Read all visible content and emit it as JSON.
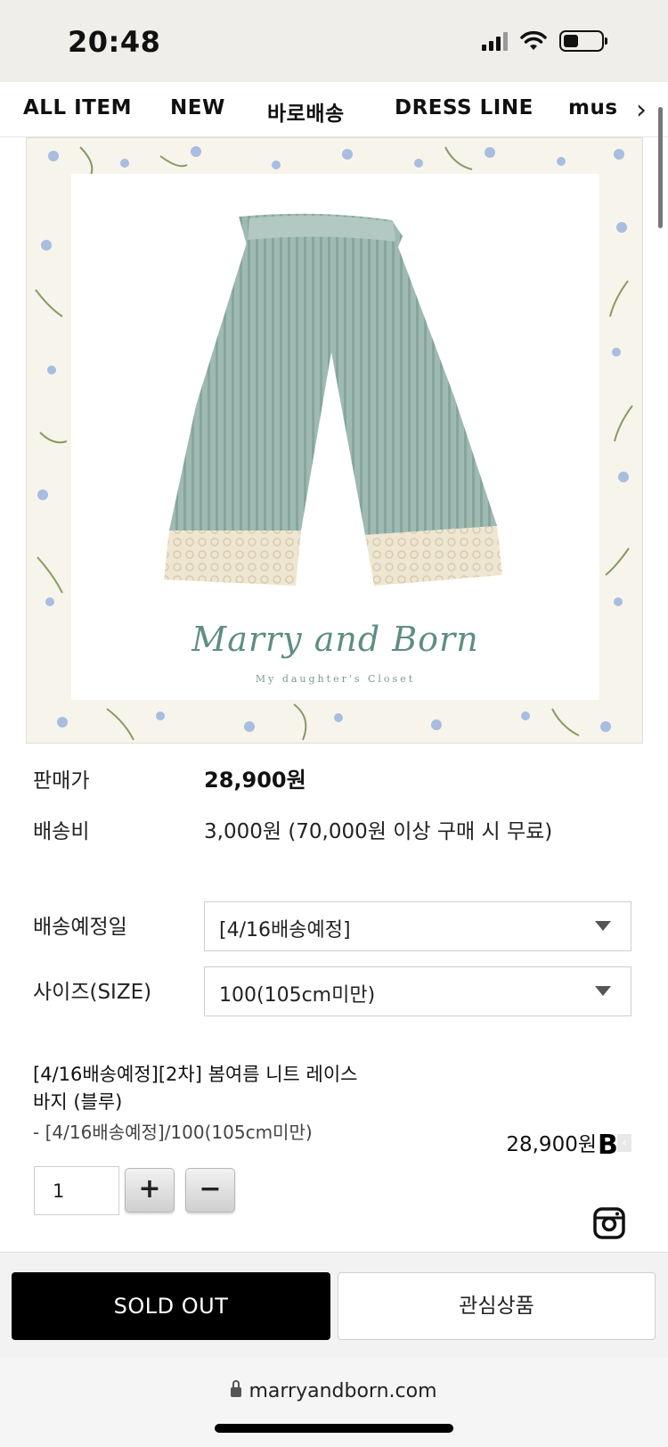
{
  "status_bar": {
    "time": "20:48"
  },
  "nav": {
    "items": [
      "ALL ITEM",
      "NEW",
      "바로배송",
      "DRESS LINE",
      "mus"
    ]
  },
  "product_image": {
    "brand": "Marry and Born",
    "tagline": "My daughter's Closet"
  },
  "info": {
    "price_label": "판매가",
    "price_value": "28,900원",
    "shipping_label": "배송비",
    "shipping_value": "3,000원 (70,000원 이상 구매 시 무료)"
  },
  "options": {
    "delivery_label": "배송예정일",
    "delivery_selected": "[4/16배송예정]",
    "size_label": "사이즈(SIZE)",
    "size_selected": "100(105cm미만)"
  },
  "selected_item": {
    "title_line1": "[4/16배송예정][2차] 봄여름 니트 레이스",
    "title_line2": "바지 (블루)",
    "option": "- [4/16배송예정]/100(105cm미만)",
    "price": "28,900원",
    "quantity": "1",
    "plus": "+",
    "minus": "−",
    "badge": "B",
    "badge_close": "‹"
  },
  "actions": {
    "sold_out": "SOLD OUT",
    "wishlist": "관심상품"
  },
  "browser": {
    "url": "marryandborn.com"
  }
}
